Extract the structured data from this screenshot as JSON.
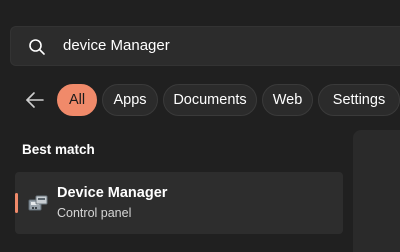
{
  "search": {
    "value": "device Manager",
    "icon": "search-icon"
  },
  "filters": {
    "back_icon": "back-arrow-icon",
    "items": [
      {
        "label": "All",
        "active": true
      },
      {
        "label": "Apps",
        "active": false
      },
      {
        "label": "Documents",
        "active": false
      },
      {
        "label": "Web",
        "active": false
      },
      {
        "label": "Settings",
        "active": false
      }
    ]
  },
  "best_match": {
    "heading": "Best match",
    "result": {
      "title": "Device Manager",
      "subtitle": "Control panel",
      "icon": "device-manager-icon"
    }
  },
  "colors": {
    "accent": "#f08a6a",
    "background": "#202020",
    "card": "#2d2d2d"
  }
}
